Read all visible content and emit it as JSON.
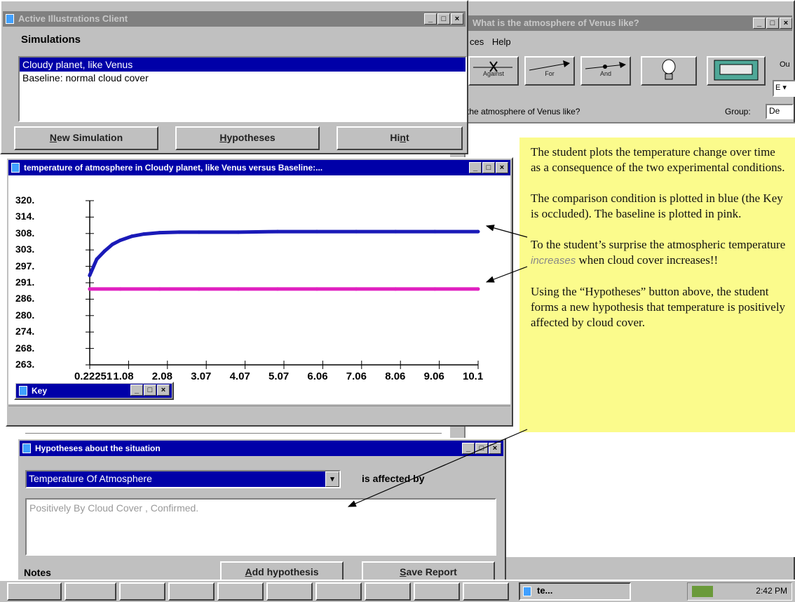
{
  "client": {
    "title": "Active Illustrations Client",
    "simulations_label": "Simulations",
    "items": [
      "Cloudy planet, like Venus",
      "Baseline: normal cloud cover"
    ],
    "buttons": {
      "new_sim_u": "N",
      "new_sim_rest": "ew Simulation",
      "hyp_u": "H",
      "hyp_rest": "ypotheses",
      "hint_a": "Hi",
      "hint_u": "n",
      "hint_b": "t"
    }
  },
  "venus_window": {
    "title": "What is the atmosphere of Venus like?",
    "menu": [
      "ces",
      "Help"
    ],
    "toolbar": [
      "Against",
      "For",
      "And"
    ],
    "question": "the atmosphere of Venus like?",
    "group_label": "Group:",
    "group_value": "De",
    "side_label": "Ou",
    "side_select": "E"
  },
  "plot": {
    "title": "temperature of atmosphere in Cloudy planet, like Venus versus Baseline:...",
    "key_title": "Key"
  },
  "chart_data": {
    "type": "line",
    "title": "temperature of atmosphere in Cloudy planet, like Venus versus Baseline:...",
    "yticks": [
      "320.",
      "314.",
      "308.",
      "303.",
      "297.",
      "291.",
      "286.",
      "280.",
      "274.",
      "268.",
      "263."
    ],
    "xticks": [
      "0.22251",
      "1.08",
      "2.08",
      "3.07",
      "4.07",
      "5.07",
      "6.06",
      "7.06",
      "8.06",
      "9.06",
      "10.1"
    ],
    "ylim": [
      263,
      320
    ],
    "xlim": [
      0.22251,
      10.1
    ],
    "series": [
      {
        "color": "#1a1ab8",
        "x": [
          0.22,
          0.4,
          0.6,
          0.8,
          1.0,
          1.3,
          1.6,
          2.0,
          2.5,
          3.0,
          4.0,
          5.0,
          6.0,
          7.0,
          8.0,
          9.0,
          10.1
        ],
        "y": [
          296,
          302,
          305,
          307.5,
          309,
          310.5,
          311.3,
          311.8,
          312,
          312,
          312,
          312.2,
          312.2,
          312.2,
          312.2,
          312.2,
          312.2
        ]
      },
      {
        "color": "#e020c0",
        "x": [
          0.22,
          1.0,
          2.0,
          3.0,
          4.0,
          5.0,
          6.0,
          7.0,
          8.0,
          9.0,
          10.1
        ],
        "y": [
          291,
          291,
          291,
          291,
          291,
          291,
          291,
          291,
          291,
          291,
          291
        ]
      }
    ]
  },
  "annotation": {
    "p1": "The student plots the temperature change over time as a consequence of the two experimental conditions.",
    "p2": "The comparison condition is plotted in blue (the Key is occluded). The baseline is plotted in pink.",
    "p3a": "To the student’s surprise the atmospheric temperature",
    "p3em": "increases",
    "p3b": "when cloud cover increases!!",
    "p4": "Using the “Hypotheses” button above, the student forms a new hypothesis that temperature is positively affected by cloud cover."
  },
  "hypotheses": {
    "title": "Hypotheses about the situation",
    "select_value": "Temperature Of Atmosphere",
    "affected_label": "is affected by",
    "text": "Positively By Cloud Cover , Confirmed.",
    "notes_label": "Notes",
    "add_u": "A",
    "add_rest": "dd hypothesis",
    "save_u": "S",
    "save_rest": "ave Report"
  },
  "taskbar": {
    "active_task": "te...",
    "clock": "2:42 PM"
  }
}
